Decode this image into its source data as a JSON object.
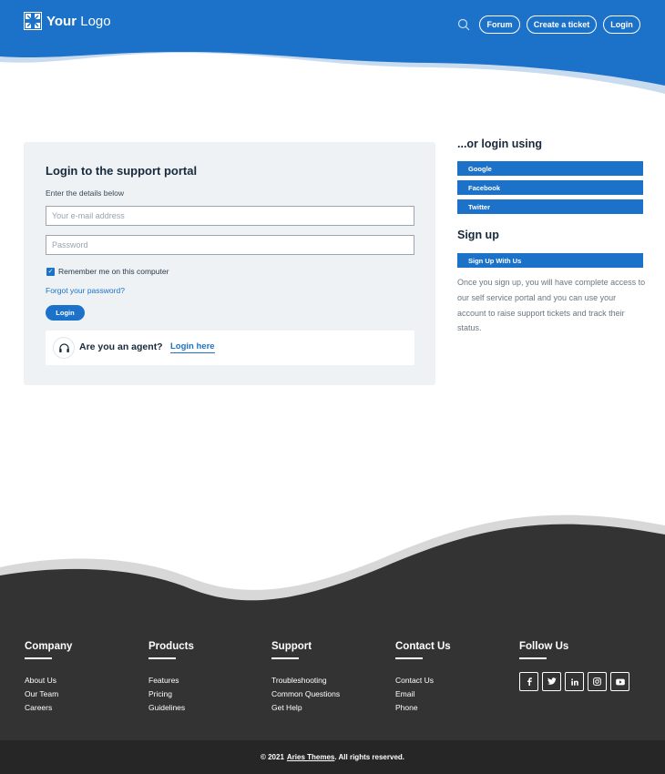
{
  "header": {
    "logo": {
      "strong": "Your",
      "light": " Logo"
    },
    "nav": [
      {
        "label": "Forum"
      },
      {
        "label": "Create a ticket"
      },
      {
        "label": "Login"
      }
    ]
  },
  "login_card": {
    "title": "Login to the support portal",
    "subtitle": "Enter the details below",
    "email_placeholder": "Your e-mail address",
    "password_placeholder": "Password",
    "remember_label": "Remember me on this computer",
    "remember_checked": true,
    "forgot_label": "Forgot your password?",
    "login_label": "Login",
    "agent_question": "Are you an agent?",
    "agent_link": "Login here"
  },
  "side": {
    "social_title": "...or login using",
    "social_buttons": [
      "Google",
      "Facebook",
      "Twitter"
    ],
    "signup_title": "Sign up",
    "signup_button": "Sign Up With Us",
    "signup_text": "Once you sign up, you will have complete access to our self service portal and you can use your account to raise support tickets and track their status."
  },
  "footer": {
    "columns": [
      {
        "title": "Company",
        "links": [
          "About Us",
          "Our Team",
          "Careers"
        ]
      },
      {
        "title": "Products",
        "links": [
          "Features",
          "Pricing",
          "Guidelines"
        ]
      },
      {
        "title": "Support",
        "links": [
          "Troubleshooting",
          "Common Questions",
          "Get Help"
        ]
      },
      {
        "title": "Contact Us",
        "links": [
          "Contact Us",
          "Email",
          "Phone"
        ]
      }
    ],
    "follow_title": "Follow Us",
    "social_icons": [
      "facebook-icon",
      "twitter-icon",
      "linkedin-icon",
      "instagram-icon",
      "youtube-icon"
    ],
    "copyright_prefix": "© 2021",
    "copyright_brand": "Aries Themes",
    "copyright_suffix": ". All rights reserved."
  },
  "colors": {
    "primary": "#1c72c9",
    "card_bg": "#eef2f5",
    "footer_bg": "#333333",
    "footer_bar": "#262626"
  }
}
